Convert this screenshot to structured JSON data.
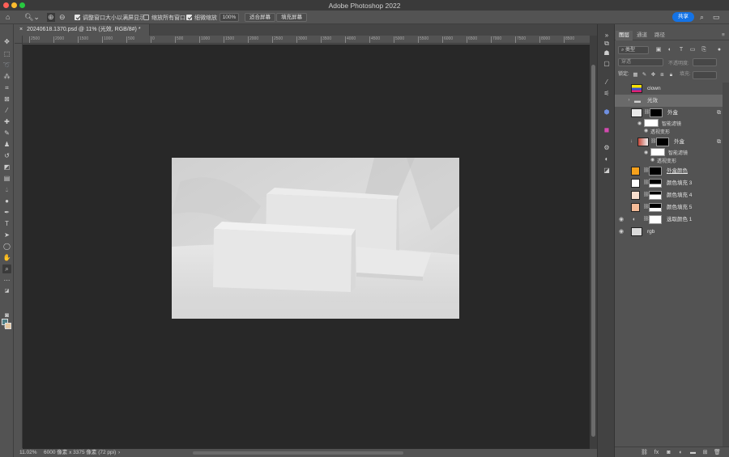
{
  "app": {
    "title": "Adobe Photoshop 2022"
  },
  "options_bar": {
    "checkbox_resize_windows": "调整窗口大小以满屏显示",
    "checkbox_zoom_all": "缩放所有窗口",
    "checkbox_scrubby": "细微缩放",
    "zoom_value": "100%",
    "fit_screen": "适合屏幕",
    "fill_screen": "填充屏幕",
    "share": "共享",
    "resize_windows_checked": true,
    "zoom_all_checked": false,
    "scrubby_checked": true
  },
  "document": {
    "tab_label": "20240618.1370.psd @ 11% (光效, RGB/8#) *"
  },
  "ruler": {
    "ticks": [
      "2500",
      "2000",
      "1500",
      "1000",
      "500",
      "0",
      "500",
      "1000",
      "1500",
      "2000",
      "2500",
      "3000",
      "3500",
      "4000",
      "4500",
      "5000",
      "5500",
      "6000",
      "6500",
      "7000",
      "7500",
      "8000",
      "8500"
    ]
  },
  "status": {
    "zoom": "11.02%",
    "doc_info": "6000 像素 x 3375 像素 (72 ppi)",
    "arrow": "›"
  },
  "layers_panel": {
    "tabs": [
      "图层",
      "通道",
      "路径"
    ],
    "active_tab": "图层",
    "filter_kind": "类型",
    "blend_mode": "穿透",
    "opacity_label": "不透明度:",
    "lock_label": "锁定:",
    "fill_label": "填充:",
    "layers": [
      {
        "name": "clown",
        "type": "layer",
        "visible": false
      },
      {
        "name": "光效",
        "type": "group",
        "visible": false,
        "selected": true
      },
      {
        "name": "外盒",
        "type": "smart",
        "visible": false,
        "sub": [
          "智能滤镜",
          "透视变形"
        ]
      },
      {
        "name": "外盒",
        "type": "smart",
        "visible": false,
        "sub": [
          "智能滤镜",
          "透视变形"
        ]
      },
      {
        "name": "外盒颜色",
        "type": "fill",
        "visible": false,
        "color": "#f5a11c"
      },
      {
        "name": "颜色填充 3",
        "type": "fill",
        "visible": false,
        "color": "#ffffff"
      },
      {
        "name": "颜色填充 4",
        "type": "fill",
        "visible": false,
        "color": "#f6ddcc"
      },
      {
        "name": "颜色填充 5",
        "type": "fill",
        "visible": false,
        "color": "#f4bb97"
      },
      {
        "name": "选取颜色 1",
        "type": "adjust",
        "visible": true
      },
      {
        "name": "rgb",
        "type": "layer",
        "visible": true
      }
    ]
  },
  "colors": {
    "accent": "#1473e6",
    "foreground": "#4f7e86",
    "background": "#e8c79a"
  }
}
